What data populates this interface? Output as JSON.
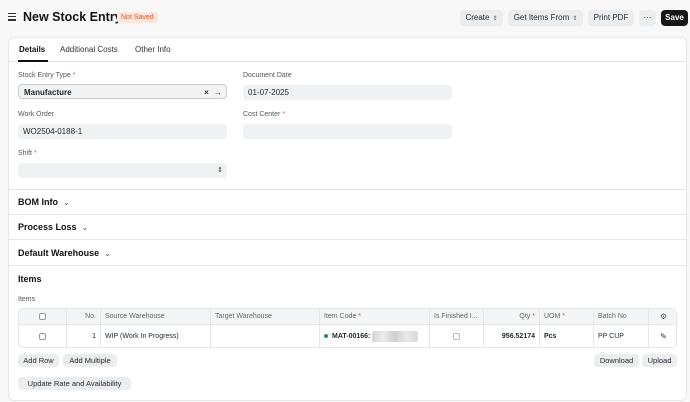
{
  "header": {
    "title": "New Stock Entry",
    "status_badge": "Not Saved",
    "buttons": {
      "create": "Create",
      "get_items_from": "Get Items From",
      "print_pdf": "Print PDF",
      "more": "···",
      "save": "Save"
    }
  },
  "tabs": [
    "Details",
    "Additional Costs",
    "Other Info"
  ],
  "form": {
    "stock_entry_type": {
      "label": "Stock Entry Type",
      "value": "Manufacture",
      "clear_icon": "×",
      "link_icon": "→"
    },
    "document_date": {
      "label": "Document Date",
      "value": "01-07-2025"
    },
    "work_order": {
      "label": "Work Order",
      "value": "WO2504-0188-1"
    },
    "cost_center": {
      "label": "Cost Center",
      "value": ""
    },
    "shift": {
      "label": "Shift",
      "value": ""
    },
    "required_mark": "*"
  },
  "sections": {
    "bom_info": "BOM Info",
    "process_loss": "Process Loss",
    "default_warehouse": "Default Warehouse",
    "items": "Items"
  },
  "items_table": {
    "label": "Items",
    "columns": [
      "No.",
      "Source Warehouse",
      "Target Warehouse",
      "Item Code",
      "Is Finished I...",
      "Qty",
      "UOM",
      "Batch No"
    ],
    "rows": [
      {
        "no": "1",
        "source_warehouse": "WIP (Work In Progress)",
        "target_warehouse": "",
        "item_code": "MAT-00166:",
        "is_finished": false,
        "qty": "956.52174",
        "uom": "Pcs",
        "batch_no": "PP CUP"
      }
    ]
  },
  "actions": {
    "add_row": "Add Row",
    "add_multiple": "Add Multiple",
    "download": "Download",
    "upload": "Upload",
    "update_rate": "Update Rate and Availability"
  },
  "icons": {
    "menu": "hamburger-icon",
    "settings": "gear-icon",
    "edit": "pencil-icon",
    "chevron": "chevron-down-icon",
    "sort": "sort-arrows-icon"
  },
  "colors": {
    "badge_bg": "#fde7dc",
    "badge_text": "#d8582a",
    "primary": "#171717",
    "required": "#e24c4c",
    "status_dot": "#2d8b57"
  }
}
